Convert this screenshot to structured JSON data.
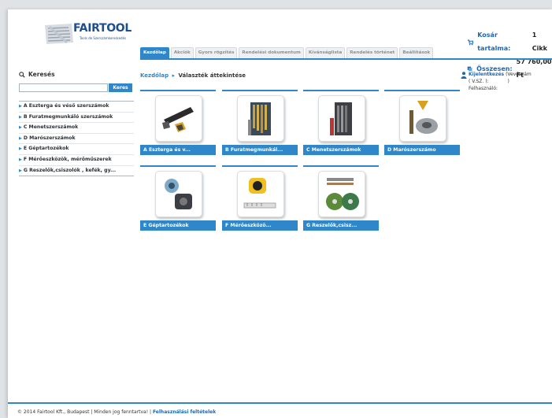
{
  "brand": {
    "name": "FAIRTOOL",
    "tagline": "Tools de Szerszámkereskedés"
  },
  "cart": {
    "label": "Kosár tartalma:",
    "value": "1 Cikk",
    "total_label": "Összesen:",
    "total_value": "57 760,00 Ft"
  },
  "nav": {
    "tabs": [
      "Kezdőlap",
      "Akciók",
      "Gyors rögzítés",
      "Rendelési dokumentum",
      "Kívánságlista",
      "Rendelés történet",
      "Beállítások"
    ]
  },
  "search": {
    "title": "Keresés",
    "button": "Keres",
    "value": ""
  },
  "categories": [
    "A Eszterga és véső szerszámok",
    "B Furatmegmunkáló szerszámok",
    "C Menetszerszámok",
    "D Marószerszámok",
    "E Géptartozékok",
    "F Mérőeszközök, mérőműszerek",
    "G Reszelők,csiszolók , kefék, gy..."
  ],
  "breadcrumb": {
    "home": "Kezdőlap",
    "separator": "▸",
    "current": "Választék áttekintése"
  },
  "login": {
    "link": "Kijelentkezés",
    "line1": "(Vevőszám",
    "line2": "( V.SZ. ):",
    "line3": ")",
    "line4": "Felhasználó:"
  },
  "tiles": [
    {
      "label": "A Eszterga és v...",
      "icon": "turning-tool-icon"
    },
    {
      "label": "B Furatmegmunkál...",
      "icon": "drill-set-icon"
    },
    {
      "label": "C Menetszerszámok",
      "icon": "tap-set-icon"
    },
    {
      "label": "D Marószerszámo",
      "icon": "milling-cutter-icon"
    },
    {
      "label": "E Géptartozékok",
      "icon": "chuck-icon"
    },
    {
      "label": "F Mérőeszközö...",
      "icon": "measuring-tape-icon"
    },
    {
      "label": "G Reszelők,csisz...",
      "icon": "grinding-disc-icon"
    }
  ],
  "footer": {
    "copyright": "© 2014 Fairtool Kft., Budapest | Minden jog fenntartva! |",
    "terms": "Felhasználási feltételek"
  },
  "colors": {
    "accent": "#2f86c8",
    "link": "#1e66b0",
    "brand": "#1d4f8e"
  }
}
